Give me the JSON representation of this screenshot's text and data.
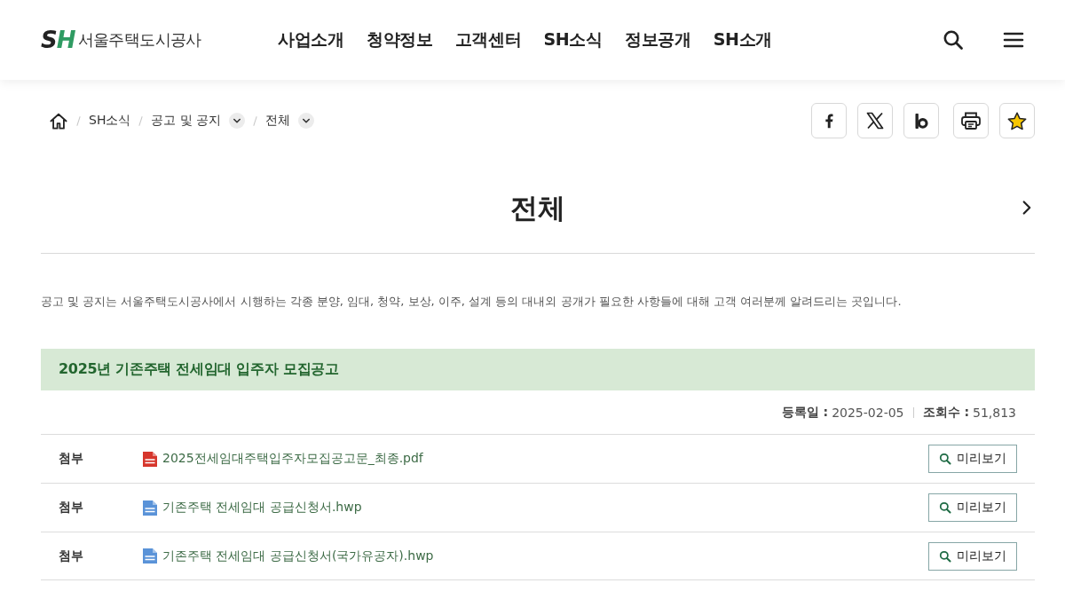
{
  "header": {
    "logo": {
      "mark": "SH",
      "name": "서울주택도시공사"
    },
    "nav": [
      "사업소개",
      "청약정보",
      "고객센터",
      "SH소식",
      "정보공개",
      "SH소개"
    ]
  },
  "breadcrumb": [
    {
      "label": "SH소식",
      "dropdown": false
    },
    {
      "label": "공고 및 공지",
      "dropdown": true
    },
    {
      "label": "전체",
      "dropdown": true
    }
  ],
  "share_buttons": [
    {
      "kind": "facebook"
    },
    {
      "kind": "x"
    },
    {
      "kind": "blog"
    },
    {
      "kind": "print"
    },
    {
      "kind": "favorite"
    }
  ],
  "page_title": "전체",
  "description": "공고 및 공지는 서울주택도시공사에서 시행하는 각종 분양, 임대, 청약, 보상, 이주, 설계 등의 대내외 공개가 필요한 사항들에 대해 고객 여러분께 알려드리는 곳입니다.",
  "notice": {
    "title": "2025년 기존주택 전세임대 입주자 모집공고",
    "meta": [
      {
        "label": "등록일 :",
        "value": "2025-02-05"
      },
      {
        "label": "조회수 :",
        "value": "51,813"
      }
    ],
    "attachments": [
      {
        "label": "첨부",
        "kind": "pdf",
        "file_name": "2025전세임대주택입주자모집공고문_최종.pdf",
        "action": "미리보기"
      },
      {
        "label": "첨부",
        "kind": "hwp",
        "file_name": "기존주택 전세임대 공급신청서.hwp",
        "action": "미리보기"
      },
      {
        "label": "첨부",
        "kind": "hwp",
        "file_name": "기존주택 전세임대 공급신청서(국가유공자).hwp",
        "action": "미리보기"
      }
    ]
  }
}
